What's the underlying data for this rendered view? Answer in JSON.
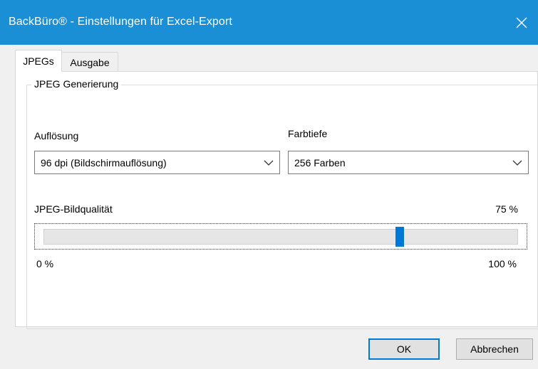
{
  "window": {
    "title": "BackBüro® - Einstellungen für Excel-Export"
  },
  "tabs": [
    {
      "label": "JPEGs",
      "active": true
    },
    {
      "label": "Ausgabe",
      "active": false
    }
  ],
  "group": {
    "title": "JPEG Generierung"
  },
  "resolution": {
    "label": "Auflösung",
    "value": "96 dpi (Bildschirmauflösung)"
  },
  "color_depth": {
    "label": "Farbtiefe",
    "value": "256 Farben"
  },
  "quality": {
    "label": "JPEG-Bildqualität",
    "value_text": "75 %",
    "value": 75,
    "min_label": "0 %",
    "max_label": "100 %",
    "min": 0,
    "max": 100
  },
  "buttons": {
    "ok": "OK",
    "cancel": "Abbrechen"
  },
  "colors": {
    "titlebar": "#1a8fd6",
    "accent": "#0078d7"
  }
}
